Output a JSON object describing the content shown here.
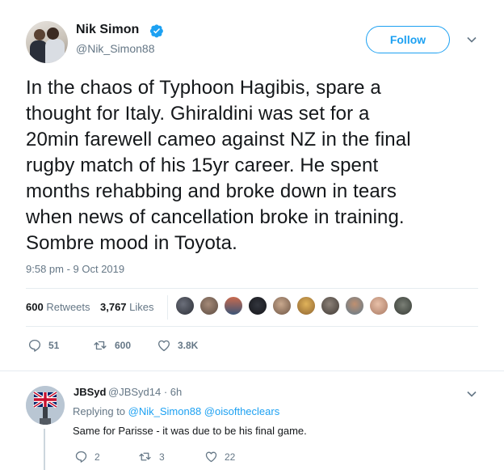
{
  "author": {
    "name": "Nik Simon",
    "handle": "@Nik_Simon88",
    "verified": true
  },
  "follow_label": "Follow",
  "tweet": {
    "text": "In the chaos of Typhoon Hagibis, spare a\nthought for Italy. Ghiraldini was set for a\n20min farewell cameo against NZ in the final\nrugby match of his 15yr career. He spent\nmonths rehabbing and broke down in tears\nwhen news of cancellation broke in training.\nSombre mood in Toyota.",
    "timestamp": "9:58 pm - 9 Oct 2019"
  },
  "stats": {
    "retweets_count": "600",
    "retweets_label": "Retweets",
    "likes_count": "3,767",
    "likes_label": "Likes"
  },
  "actions": {
    "reply_count": "51",
    "retweet_count": "600",
    "like_count": "3.8K"
  },
  "reply": {
    "name": "JBSyd",
    "handle_time": "@JBSyd14 · 6h",
    "replying_prefix": "Replying to",
    "replying_to": "@Nik_Simon88 @oisoftheclears",
    "text": "Same for Parisse - it was due to be his final game.",
    "reply_count": "2",
    "retweet_count": "3",
    "like_count": "22"
  },
  "icons": {
    "verified": "verified-badge-icon",
    "caret": "chevron-down-icon",
    "reply": "reply-icon",
    "retweet": "retweet-icon",
    "like": "heart-icon"
  },
  "colors": {
    "accent": "#1da1f2",
    "text": "#14171a",
    "muted": "#657786",
    "divider": "#e6ecf0"
  }
}
